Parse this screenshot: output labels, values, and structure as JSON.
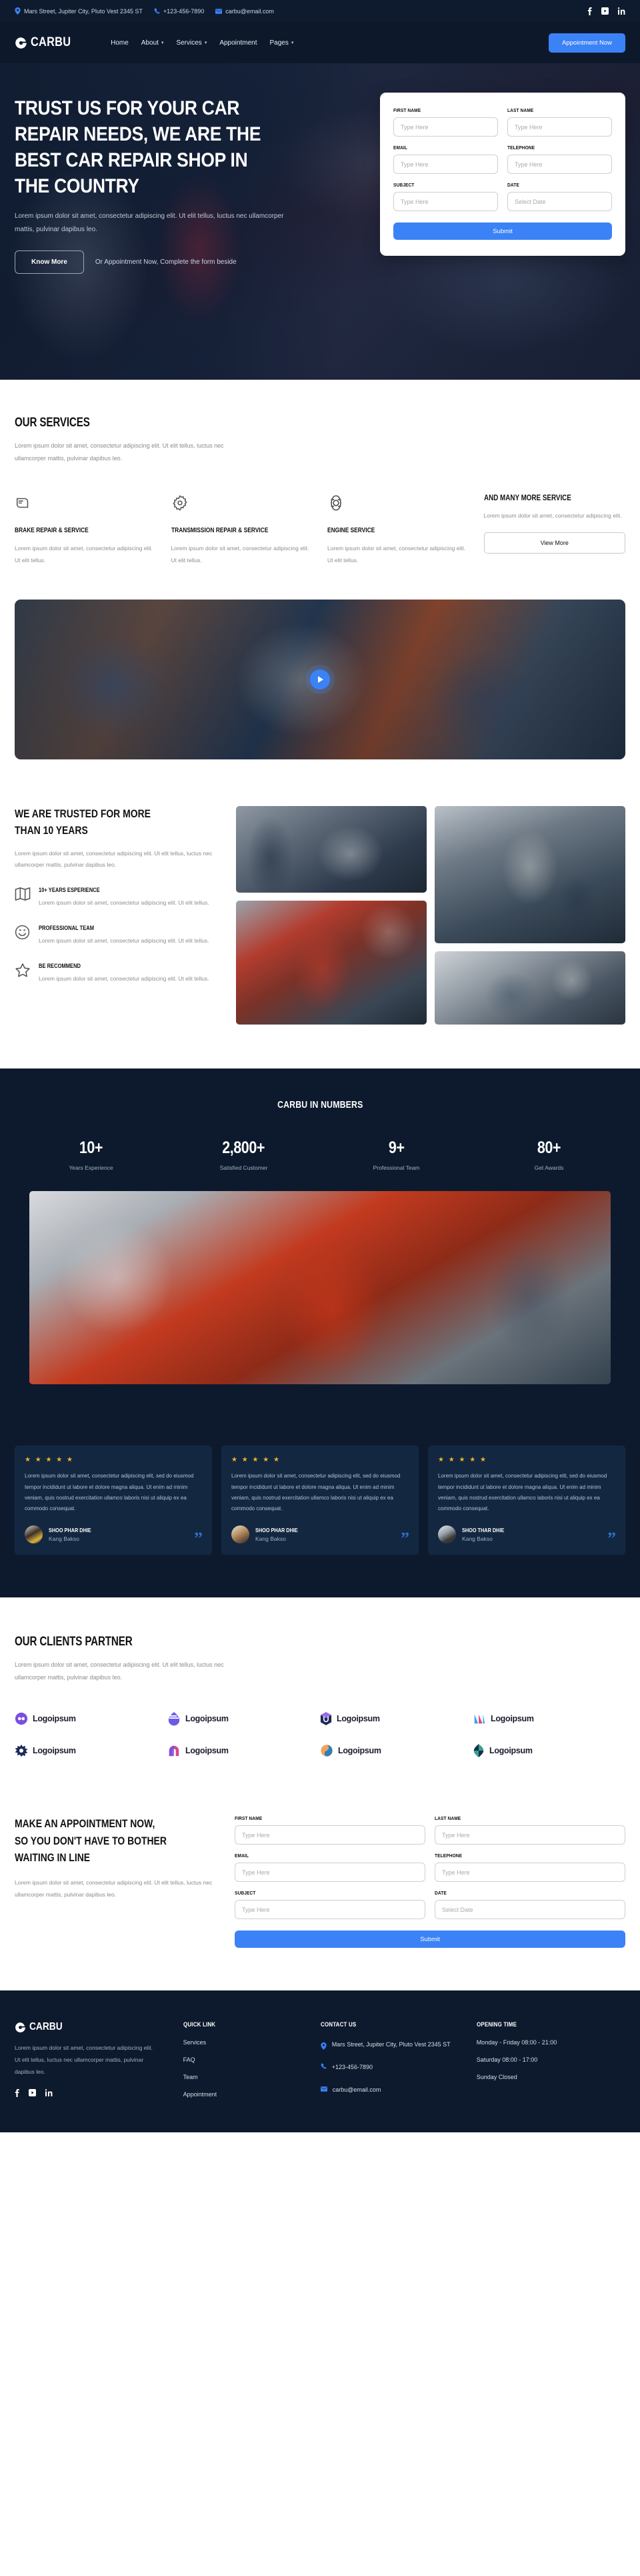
{
  "topbar": {
    "address": "Mars Street, Jupiter City, Pluto Vest 2345 ST",
    "phone": "+123-456-7890",
    "email": "carbu@email.com",
    "socials": [
      "facebook-icon",
      "youtube-icon",
      "linkedin-icon"
    ]
  },
  "navbar": {
    "brand": "CARBU",
    "links": [
      {
        "label": "Home",
        "caret": false
      },
      {
        "label": "About",
        "caret": true
      },
      {
        "label": "Services",
        "caret": true
      },
      {
        "label": "Appointment",
        "caret": false
      },
      {
        "label": "Pages",
        "caret": true
      }
    ],
    "cta": "Appointment Now"
  },
  "hero": {
    "title_lines": [
      "TRUST US FOR YOUR CAR",
      "REPAIR NEEDS, WE ARE THE",
      "BEST CAR REPAIR SHOP IN",
      "THE COUNTRY"
    ],
    "subtitle": "Lorem ipsum dolor sit amet, consectetur adipiscing elit. Ut elit tellus, luctus nec ullamcorper mattis, pulvinar dapibus leo.",
    "button": "Know More",
    "note": "Or Appointment Now, Complete the form beside"
  },
  "hero_form": {
    "fields": [
      {
        "label": "FIRST NAME",
        "placeholder": "Type Here"
      },
      {
        "label": "LAST NAME",
        "placeholder": "Type Here"
      },
      {
        "label": "EMAIL",
        "placeholder": "Type Here"
      },
      {
        "label": "TELEPHONE",
        "placeholder": "Type Here"
      },
      {
        "label": "SUBJECT",
        "placeholder": "Type Here"
      },
      {
        "label": "DATE",
        "placeholder": "Select Date"
      }
    ],
    "submit": "Submit"
  },
  "services": {
    "title": "OUR SERVICES",
    "desc": "Lorem ipsum dolor sit amet, consectetur adipiscing elit. Ut elit tellus, luctus nec ullamcorper mattis, pulvinar dapibus leo.",
    "items": [
      {
        "icon": "brake-pad-icon",
        "name": "BRAKE REPAIR & SERVICE",
        "text": "Lorem ipsum dolor sit amet, consectetur adipiscing elit. Ut elit tellus."
      },
      {
        "icon": "gear-icon",
        "name": "TRANSMISSION REPAIR & SERVICE",
        "text": "Lorem ipsum dolor sit amet, consectetur adipiscing elit. Ut elit tellus."
      },
      {
        "icon": "engine-piston-icon",
        "name": "ENGINE SERVICE",
        "text": "Lorem ipsum dolor sit amet, consectetur adipiscing elit. Ut elit tellus."
      }
    ],
    "more_title": "AND MANY MORE SERVICE",
    "more_text": "Lorem ipsum dolor sit amet, consectetur adipiscing elit.",
    "more_button": "View More"
  },
  "video": {
    "play": "play-icon"
  },
  "trusted": {
    "title_lines": [
      "WE ARE TRUSTED FOR MORE",
      "THAN 10 YEARS"
    ],
    "desc": "Lorem ipsum dolor sit amet, consectetur adipiscing elit. Ut elit tellus, luctus nec ullamcorper mattis, pulvinar dapibus leo.",
    "features": [
      {
        "icon": "map-icon",
        "name": "10+ YEARS ESPERIENCE",
        "text": "Lorem ipsum dolor sit amet, consectetur adipiscing elit. Ut elit tellus."
      },
      {
        "icon": "smile-icon",
        "name": "PROFESSIONAL TEAM",
        "text": "Lorem ipsum dolor sit amet, consectetur adipiscing elit. Ut elit tellus."
      },
      {
        "icon": "star-icon",
        "name": "BE RECOMMEND",
        "text": "Lorem ipsum dolor sit amet, consectetur adipiscing elit. Ut elit tellus."
      }
    ]
  },
  "numbers": {
    "title": "CARBU IN NUMBERS",
    "stats": [
      {
        "value": "10+",
        "label": "Years Experience"
      },
      {
        "value": "2,800+",
        "label": "Satisfied Customer"
      },
      {
        "value": "9+",
        "label": "Professional Team"
      },
      {
        "value": "80+",
        "label": "Get Awards"
      }
    ]
  },
  "testimonials": [
    {
      "stars": "★ ★ ★ ★ ★",
      "text": "Lorem ipsum dolor sit amet, consectetur adipiscing elit, sed do eiusmod tempor incididunt ut labore et dolore magna aliqua. Ut enim ad minim veniam, quis nostrud exercitation ullamco laboris nisi ut aliquip ex ea commodo consequat.",
      "name": "SHOO PHAR DHIE",
      "role": "Kang Bakso"
    },
    {
      "stars": "★ ★ ★ ★ ★",
      "text": "Lorem ipsum dolor sit amet, consectetur adipiscing elit, sed do eiusmod tempor incididunt ut labore et dolore magna aliqua. Ut enim ad minim veniam, quis nostrud exercitation ullamco laboris nisi ut aliquip ex ea commodo consequat.",
      "name": "SHOO PHAR DHIE",
      "role": "Kang Bakso"
    },
    {
      "stars": "★ ★ ★ ★ ★",
      "text": "Lorem ipsum dolor sit amet, consectetur adipiscing elit, sed do eiusmod tempor incididunt ut labore et dolore magna aliqua. Ut enim ad minim veniam, quis nostrud exercitation ullamco laboris nisi ut aliquip ex ea commodo consequat.",
      "name": "SHOO THAR DHIE",
      "role": "Kang Bakso"
    }
  ],
  "partners": {
    "title": "OUR CLIENTS PARTNER",
    "desc": "Lorem ipsum dolor sit amet, consectetur adipiscing elit. Ut elit tellus, luctus nec ullamcorper mattis, pulvinar dapibus leo.",
    "logos": [
      {
        "name": "Logoipsum",
        "mark": "infinity-mark-icon",
        "color": "#7C4DE0"
      },
      {
        "name": "Logoipsum",
        "mark": "wave-drop-mark-icon",
        "color": "#6B5BE6"
      },
      {
        "name": "Logoipsum",
        "mark": "shield-mark-icon",
        "color": "#1E2A5A"
      },
      {
        "name": "Logoipsum",
        "mark": "arrow-bars-mark-icon",
        "color": "#3AA0F0"
      },
      {
        "name": "Logoipsum",
        "mark": "burst-mark-icon",
        "color": "#1E2A5A"
      },
      {
        "name": "Logoipsum",
        "mark": "arch-mark-icon",
        "color": "#D14A8E"
      },
      {
        "name": "Logoipsum",
        "mark": "swirl-mark-icon",
        "color": "#F0A060"
      },
      {
        "name": "Logoipsum",
        "mark": "leaf-diamond-mark-icon",
        "color": "#2FA87F"
      }
    ]
  },
  "appointment": {
    "title_lines": [
      "MAKE AN APPOINTMENT NOW,",
      "SO YOU DON'T HAVE TO BOTHER",
      "WAITING IN LINE"
    ],
    "desc": "Lorem ipsum dolor sit amet, consectetur adipiscing elit. Ut elit tellus, luctus nec ullamcorper mattis, pulvinar dapibus leo.",
    "fields": [
      {
        "label": "FIRST NAME",
        "placeholder": "Type Here"
      },
      {
        "label": "LAST NAME",
        "placeholder": "Type Here"
      },
      {
        "label": "EMAIL",
        "placeholder": "Type Here"
      },
      {
        "label": "TELEPHONE",
        "placeholder": "Type Here"
      },
      {
        "label": "SUBJECT",
        "placeholder": "Type Here"
      },
      {
        "label": "DATE",
        "placeholder": "Select Date"
      }
    ],
    "submit": "Submit"
  },
  "footer": {
    "brand": "CARBU",
    "desc": "Lorem ipsum dolor sit amet, consectetur adipiscing elit. Ut elit tellus, luctus nec ullamcorper mattis, pulvinar dapibus leo.",
    "socials": [
      "facebook-icon",
      "youtube-icon",
      "linkedin-icon"
    ],
    "quick_link": {
      "title": "QUICK LINK",
      "items": [
        "Services",
        "FAQ",
        "Team",
        "Appointment"
      ]
    },
    "contact": {
      "title": "CONTACT US",
      "address": "Mars Street, Jupiter City, Pluto Vest 2345 ST",
      "phone": "+123-456-7890",
      "email": "carbu@email.com"
    },
    "opening": {
      "title": "OPENING TIME",
      "rows": [
        "Monday - Friday 08:00 - 21:00",
        "Saturday 08:00 - 17:00",
        "Sunday Closed"
      ]
    }
  },
  "accent": "#3b82f6",
  "dark": "#0d1a2d"
}
